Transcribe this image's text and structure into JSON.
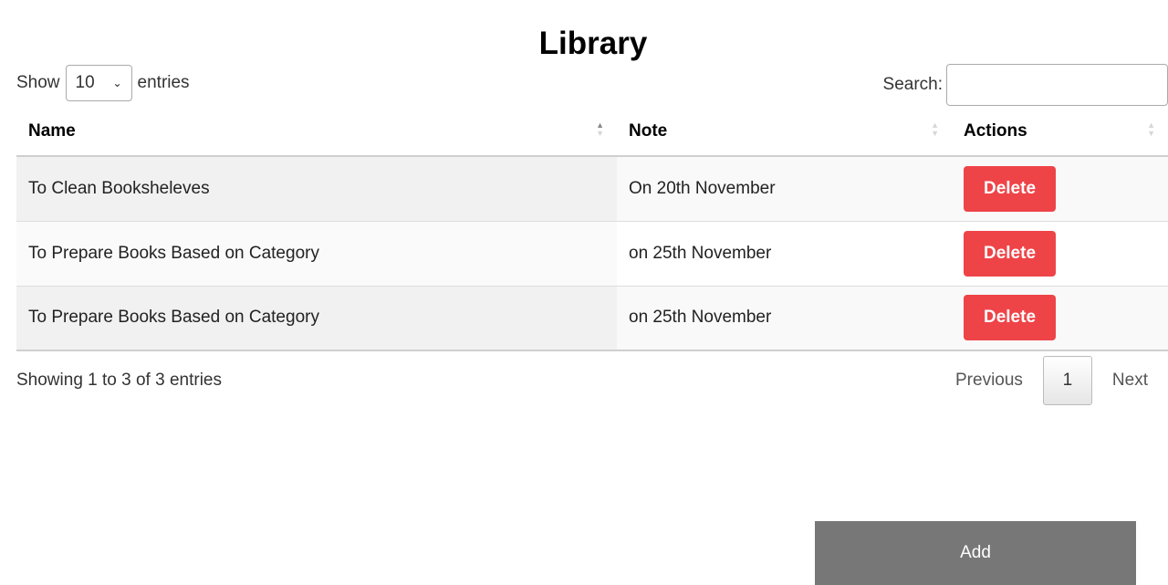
{
  "page": {
    "title": "Library"
  },
  "length_control": {
    "prefix": "Show",
    "selected": "10",
    "suffix": "entries",
    "chevron_icon": "chevron-down-icon"
  },
  "search": {
    "label": "Search:",
    "value": "",
    "placeholder": ""
  },
  "table": {
    "columns": [
      {
        "label": "Name",
        "sort": "ascending"
      },
      {
        "label": "Note",
        "sort": "none"
      },
      {
        "label": "Actions",
        "sort": "none"
      }
    ],
    "rows": [
      {
        "name": "To Clean Booksheleves",
        "note": "On 20th November",
        "action": "Delete"
      },
      {
        "name": "To Prepare Books Based on Category",
        "note": "on 25th November",
        "action": "Delete"
      },
      {
        "name": "To Prepare Books Based on Category",
        "note": "on 25th November",
        "action": "Delete"
      }
    ]
  },
  "footer": {
    "info": "Showing 1 to 3 of 3 entries",
    "pagination": {
      "previous": "Previous",
      "current_page": "1",
      "next": "Next"
    }
  },
  "add_button": {
    "label": "Add"
  },
  "colors": {
    "delete": "#ee4448",
    "add": "#777777"
  }
}
